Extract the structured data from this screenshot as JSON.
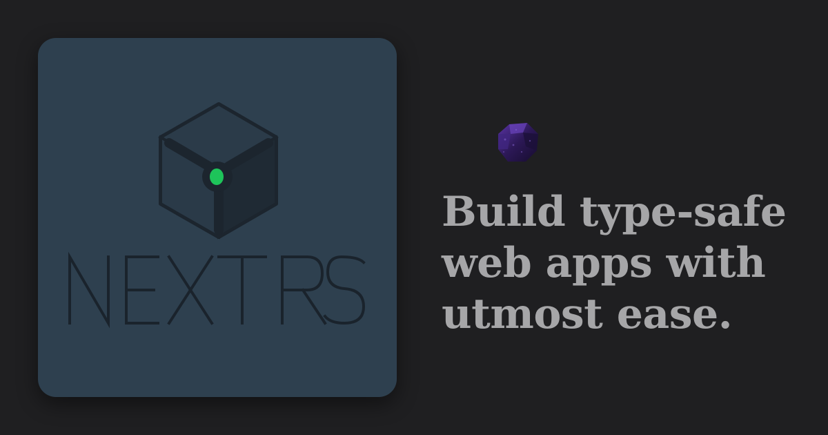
{
  "logo": {
    "wordmark": "NEXT RS",
    "accent_color": "#1ec45a",
    "card_color": "#2e404f"
  },
  "tagline": {
    "lines": [
      "Build type-safe",
      "web apps with",
      "utmost ease."
    ]
  },
  "colors": {
    "background": "#1f1f21",
    "text": "#a6a6a8",
    "gem": "#3a1f6a"
  }
}
